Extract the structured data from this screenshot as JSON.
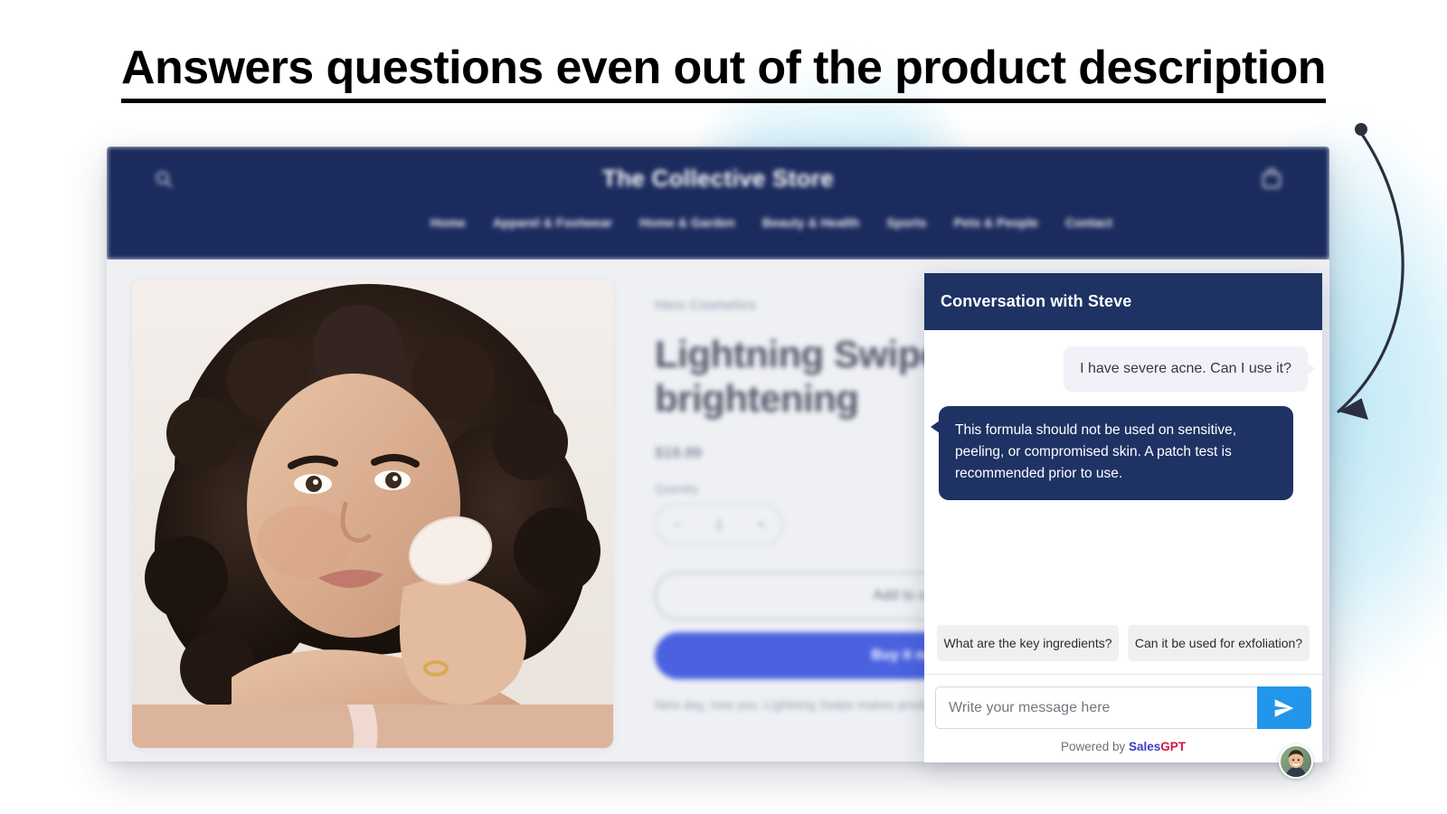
{
  "headline": {
    "text": "Answers questions even out of the product description"
  },
  "store": {
    "brand": "The Collective Store",
    "search_icon": "search-icon",
    "cart_icon": "cart-icon",
    "nav_links": [
      "Home",
      "Apparel & Footwear",
      "Home & Garden",
      "Beauty & Health",
      "Sports",
      "Pets & People",
      "Contact"
    ],
    "product": {
      "vendor": "Hero Cosmetics",
      "title": "Lightning Swipe over brightening",
      "price": "$19.99",
      "quantity_label": "Quantity",
      "quantity_minus": "−",
      "quantity_value": "1",
      "quantity_plus": "+",
      "add_to_cart_label": "Add to cart",
      "buy_now_label": "Buy it now",
      "description": "New day, new you. Lightning Swipe makes products your skincare."
    },
    "colors": {
      "nav_navy": "#1c2b5e",
      "buy_now_blue": "#4a62e0",
      "page_bg": "#eef0f4"
    }
  },
  "chat": {
    "header_title": "Conversation with Steve",
    "messages": [
      {
        "sender": "user",
        "text": "I have severe acne. Can I use it?"
      },
      {
        "sender": "bot",
        "text": "This formula should not be used on sensitive, peeling, or compromised skin. A patch test is recommended prior to use."
      }
    ],
    "suggestions": [
      "What are the key ingredients?",
      "Can it be used for exfoliation?"
    ],
    "input": {
      "placeholder": "Write your message here",
      "value": ""
    },
    "send_icon": "send-paper-plane-icon",
    "footer": {
      "prefix": "Powered by ",
      "brand_first": "Sales",
      "brand_second": "GPT"
    },
    "avatar": "bot-avatar-steve",
    "colors": {
      "header_navy": "#1e3264",
      "bot_bubble": "#1e3264",
      "user_bubble": "#f2f1f8",
      "send_blue": "#2196ea",
      "chip_gray": "#f0f0f0",
      "sales_blue": "#3b3bc4",
      "gpt_red": "#d4144b"
    }
  },
  "annotation": {
    "name": "curved-arrow-pointing-to-bot-reply",
    "color": "#2b3040"
  }
}
